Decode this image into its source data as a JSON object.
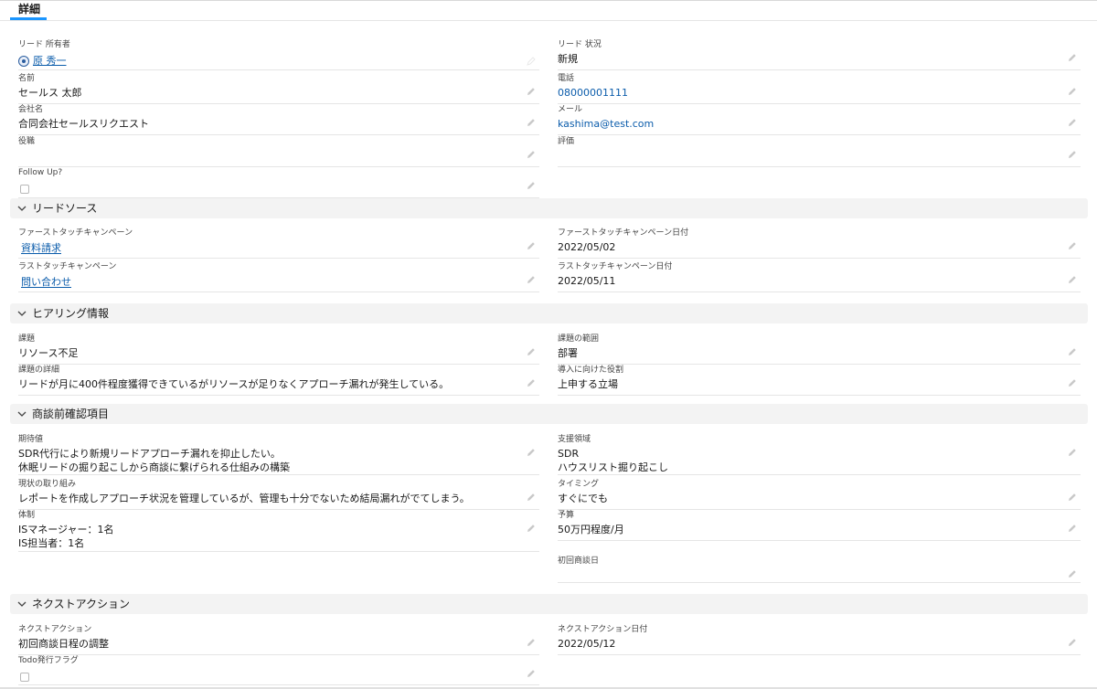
{
  "tab": {
    "label": "詳細"
  },
  "fields": {
    "lead_owner": {
      "label": "リード 所有者",
      "value": "原 秀一"
    },
    "lead_status": {
      "label": "リード 状況",
      "value": "新規"
    },
    "name": {
      "label": "名前",
      "value": "セールス 太郎"
    },
    "phone": {
      "label": "電話",
      "value": "08000001111"
    },
    "company": {
      "label": "会社名",
      "value": "合同会社セールスリクエスト"
    },
    "email": {
      "label": "メール",
      "value": "kashima@test.com"
    },
    "title": {
      "label": "役職",
      "value": ""
    },
    "rating": {
      "label": "評価",
      "value": ""
    },
    "follow_up": {
      "label": "Follow Up?",
      "checked": false
    },
    "first_touch_campaign": {
      "label": "ファーストタッチキャンペーン",
      "value": "資料請求"
    },
    "first_touch_date": {
      "label": "ファーストタッチキャンペーン日付",
      "value": "2022/05/02"
    },
    "last_touch_campaign": {
      "label": "ラストタッチキャンペーン",
      "value": "問い合わせ"
    },
    "last_touch_date": {
      "label": "ラストタッチキャンペーン日付",
      "value": "2022/05/11"
    },
    "issue": {
      "label": "課題",
      "value": "リソース不足"
    },
    "issue_scope": {
      "label": "課題の範囲",
      "value": "部署"
    },
    "issue_detail": {
      "label": "課題の詳細",
      "value": "リードが月に400件程度獲得できているがリソースが足りなくアプローチ漏れが発生している。"
    },
    "role_for_adoption": {
      "label": "導入に向けた役割",
      "value": "上申する立場"
    },
    "expectation": {
      "label": "期待値",
      "line1": "SDR代行により新規リードアプローチ漏れを抑止したい。",
      "line2": "休眠リードの掘り起こしから商談に繋げられる仕組みの構築"
    },
    "support_area": {
      "label": "支援領域",
      "line1": "SDR",
      "line2": "ハウスリスト掘り起こし"
    },
    "current_effort": {
      "label": "現状の取り組み",
      "value": "レポートを作成しアプローチ状況を管理しているが、管理も十分でないため結局漏れがでてしまう。"
    },
    "timing": {
      "label": "タイミング",
      "value": "すぐにでも"
    },
    "structure": {
      "label": "体制",
      "line1": "ISマネージャー：1名",
      "line2": "IS担当者：1名"
    },
    "budget": {
      "label": "予算",
      "value": "50万円程度/月"
    },
    "first_meeting_date": {
      "label": "初回商談日",
      "value": ""
    },
    "next_action": {
      "label": "ネクストアクション",
      "value": "初回商談日程の調整"
    },
    "next_action_date": {
      "label": "ネクストアクション日付",
      "value": "2022/05/12"
    },
    "todo_flag": {
      "label": "Todo発行フラグ",
      "checked": false
    }
  },
  "sections": {
    "lead_source": "リードソース",
    "hearing": "ヒアリング情報",
    "pre_meeting": "商談前確認項目",
    "next_action": "ネクストアクション"
  },
  "icons": {
    "edit": "pencil-icon",
    "collapse": "chevron-down-icon",
    "owner": "user-avatar-icon"
  },
  "colors": {
    "link": "#0b5cab",
    "tab_underline": "#1b96ff",
    "section_bg": "#f3f3f3"
  }
}
